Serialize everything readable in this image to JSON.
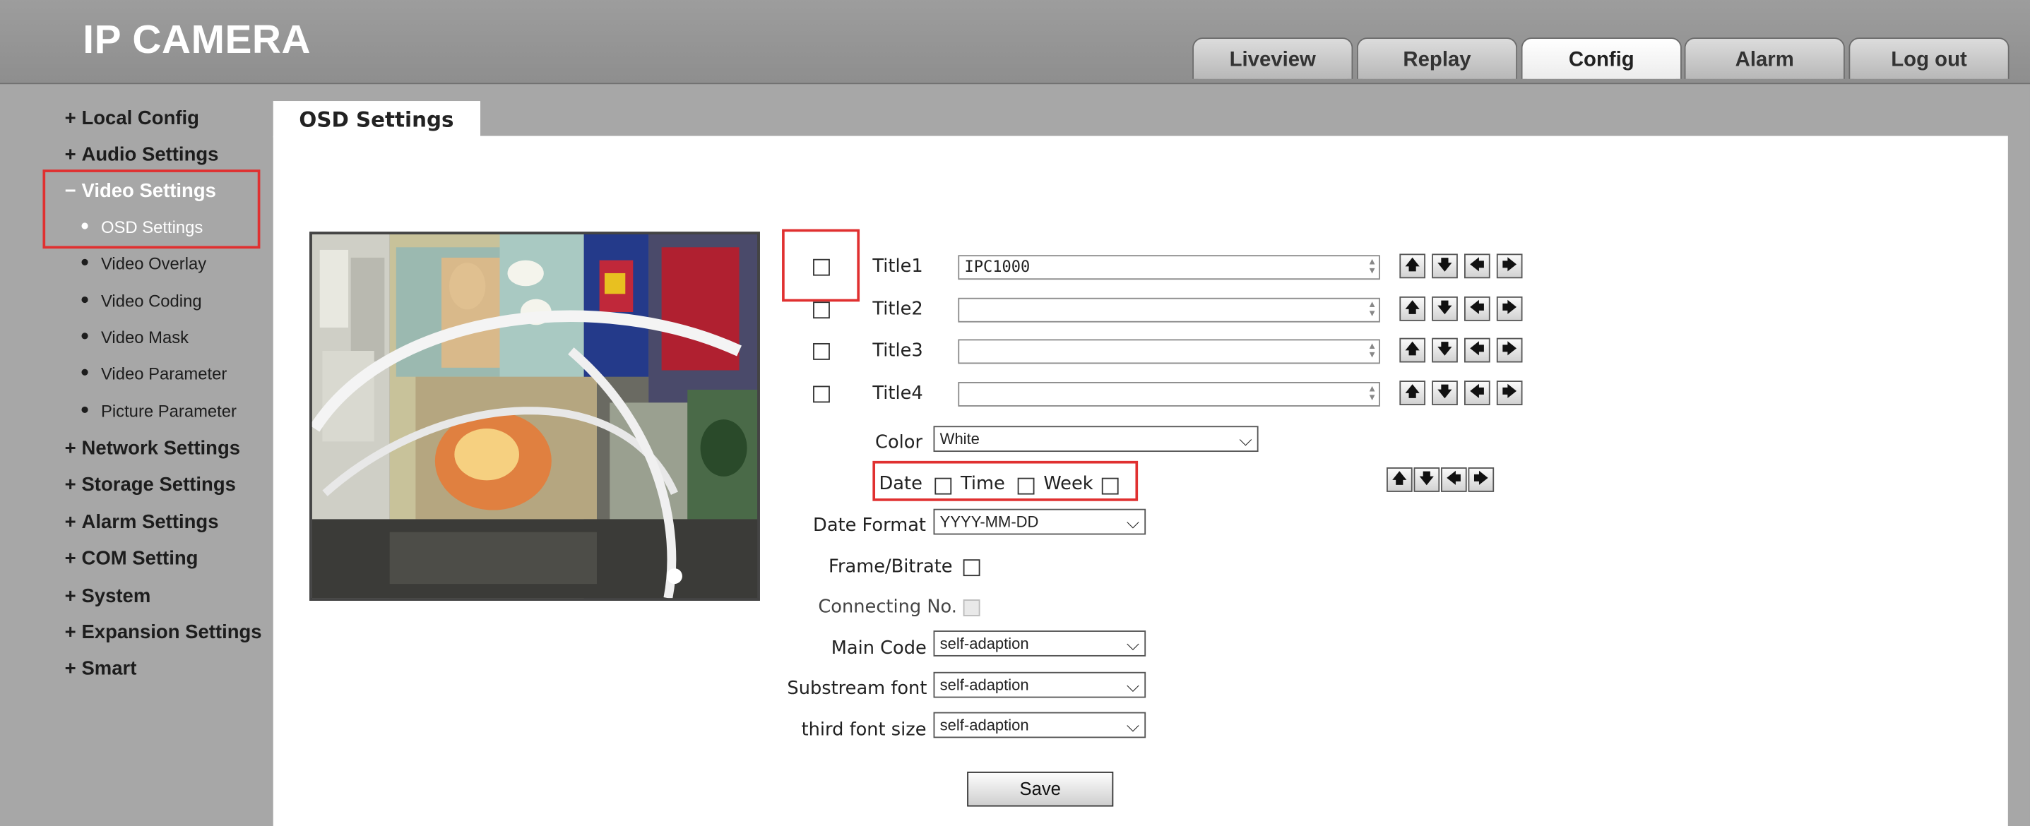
{
  "app": {
    "title": "IP CAMERA"
  },
  "nav": {
    "tabs": [
      {
        "label": "Liveview"
      },
      {
        "label": "Replay"
      },
      {
        "label": "Config"
      },
      {
        "label": "Alarm"
      },
      {
        "label": "Log out"
      }
    ],
    "active": "Config"
  },
  "sidebar": {
    "expand_sign": "+",
    "collapse_sign": "−",
    "groups": [
      {
        "label": "Local Config"
      },
      {
        "label": "Audio Settings"
      },
      {
        "label": "Video Settings"
      },
      {
        "label": "Network Settings"
      },
      {
        "label": "Storage Settings"
      },
      {
        "label": "Alarm Settings"
      },
      {
        "label": "COM Setting"
      },
      {
        "label": "System"
      },
      {
        "label": "Expansion Settings"
      },
      {
        "label": "Smart"
      }
    ],
    "video_items": [
      {
        "label": "OSD Settings"
      },
      {
        "label": "Video Overlay"
      },
      {
        "label": "Video Coding"
      },
      {
        "label": "Video Mask"
      },
      {
        "label": "Video Parameter"
      },
      {
        "label": "Picture Parameter"
      }
    ]
  },
  "page": {
    "title": "OSD Settings"
  },
  "osd": {
    "titles": [
      {
        "label": "Title1",
        "value": "IPC1000",
        "checked": false
      },
      {
        "label": "Title2",
        "value": "",
        "checked": false
      },
      {
        "label": "Title3",
        "value": "",
        "checked": false
      },
      {
        "label": "Title4",
        "value": "",
        "checked": false
      }
    ],
    "color": {
      "label": "Color",
      "value": "White"
    },
    "date_row": {
      "date": "Date",
      "time": "Time",
      "week": "Week"
    },
    "date_format": {
      "label": "Date Format",
      "value": "YYYY-MM-DD"
    },
    "frame_bitrate": {
      "label": "Frame/Bitrate"
    },
    "connecting_no": {
      "label": "Connecting No."
    },
    "main_code": {
      "label": "Main Code",
      "value": "self-adaption"
    },
    "substream_font": {
      "label": "Substream font",
      "value": "self-adaption"
    },
    "third_font_size": {
      "label": "third font size",
      "value": "self-adaption"
    },
    "save_label": "Save",
    "arrows": {
      "up": "🡅",
      "down": "🡇",
      "left": "🡄",
      "right": "🡆"
    }
  }
}
